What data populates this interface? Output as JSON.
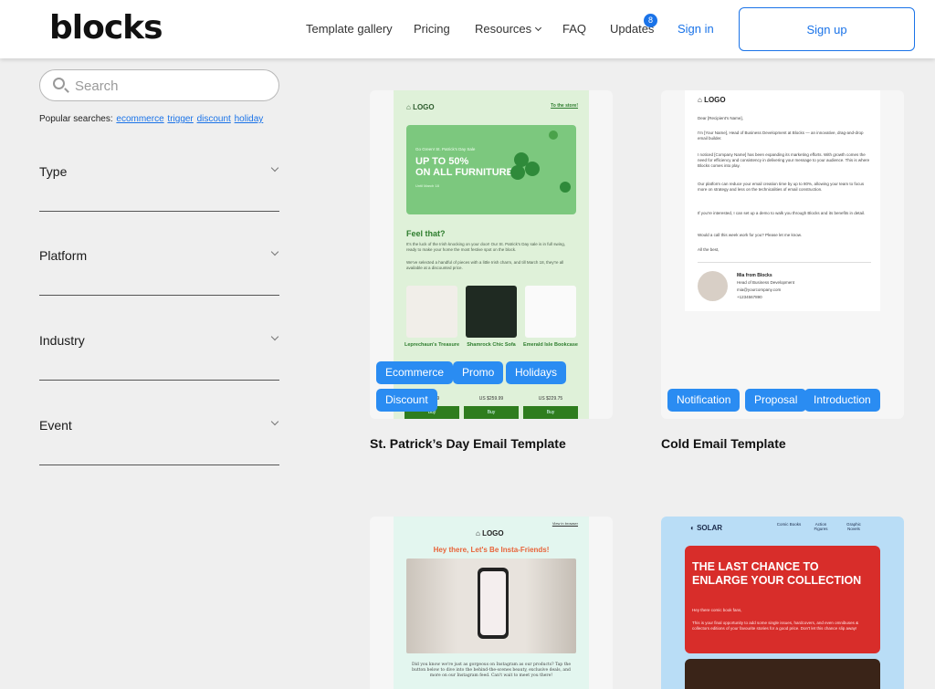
{
  "header": {
    "logo": "blocks",
    "nav": {
      "template_gallery": "Template gallery",
      "pricing": "Pricing",
      "resources": "Resources",
      "faq": "FAQ",
      "updates": "Updates",
      "updates_badge": "8",
      "sign_in": "Sign in",
      "sign_up": "Sign up"
    }
  },
  "sidebar": {
    "search_placeholder": "Search",
    "popular_label": "Popular searches:",
    "popular": [
      "ecommerce",
      "trigger",
      "discount",
      "holiday"
    ],
    "filters": [
      "Type",
      "Platform",
      "Industry",
      "Event"
    ]
  },
  "templates": [
    {
      "title": "St. Patrick’s Day Email Template",
      "tags": [
        "Ecommerce",
        "Promo",
        "Holidays",
        "Discount"
      ],
      "preview": {
        "logo": "LOGO",
        "store_link": "To the store!",
        "hero_small": "Go Green! St. Patrick's Day Sale",
        "hero_big_1": "UP TO 50%",
        "hero_big_2": "ON ALL FURNITURE",
        "hero_date": "Until March 18",
        "heading": "Feel that?",
        "para1": "It's the luck of the Irish knocking on your door! Our St. Patrick's Day sale is in full swing, ready to make your home the most festive spot on the block.",
        "para2": "We've selected a handful of pieces with a little Irish charm, and till March 18, they're all available at a discounted price.",
        "products": [
          {
            "name": "Leprechaun's Treasure",
            "price": "US $99",
            "buy": "Buy"
          },
          {
            "name": "Shamrock Chic Sofa",
            "price": "US $259.99",
            "buy": "Buy"
          },
          {
            "name": "Emerald Isle Bookcase",
            "price": "US $229.75",
            "buy": "Buy"
          }
        ]
      }
    },
    {
      "title": "Cold Email Template",
      "tags": [
        "Notification",
        "Proposal",
        "Introduction"
      ],
      "preview": {
        "logo": "LOGO",
        "lines": [
          "Dear [Recipient's Name],",
          "I'm [Your Name], Head of Business Development at Blocks — an innovative, drag-and-drop email builder.",
          "I noticed [Company Name] has been expanding its marketing efforts. With growth comes the need for efficiency and consistency in delivering your message to your audience. This is where Blocks comes into play.",
          "Our platform can reduce your email creation time by up to 80%, allowing your team to focus more on strategy and less on the technicalities of email construction.",
          "If you're interested, I can set up a demo to walk you through Blocks and its benefits in detail.",
          "Would a call this week work for you? Please let me know.",
          "All the best,"
        ],
        "sig_name": "Mia from Blocks",
        "sig_role": "Head of Business Development",
        "sig_email": "mia@yourcompany.com",
        "sig_phone": "+1234567890"
      }
    },
    {
      "title": "",
      "preview": {
        "logo": "LOGO",
        "browser_link": "View in browser",
        "heading": "Hey there, Let's Be Insta-Friends!",
        "para": "Did you know we're just as gorgeous on Instagram as our products? Tap the button below to dive into the behind-the-scenes beauty, exclusive deals, and more on our Instagram feed. Can't wait to meet you there!"
      }
    },
    {
      "title": "",
      "preview": {
        "logo": "SOLAR",
        "nav": [
          "Comic Books",
          "Action Figures",
          "Graphic Novels"
        ],
        "heading": "THE LAST CHANCE TO ENLARGE YOUR COLLECTION",
        "greeting": "Hey there comic book fans,",
        "para": "This is your final opportunity to add some single issues, hardcovers, and even omnibuses & collectors editions of your favourite stories for a good price. Don't let this chance slip away!"
      }
    }
  ],
  "colors": {
    "accent": "#1a73e8",
    "tag": "#2a8cf2",
    "background": "#efefef"
  }
}
